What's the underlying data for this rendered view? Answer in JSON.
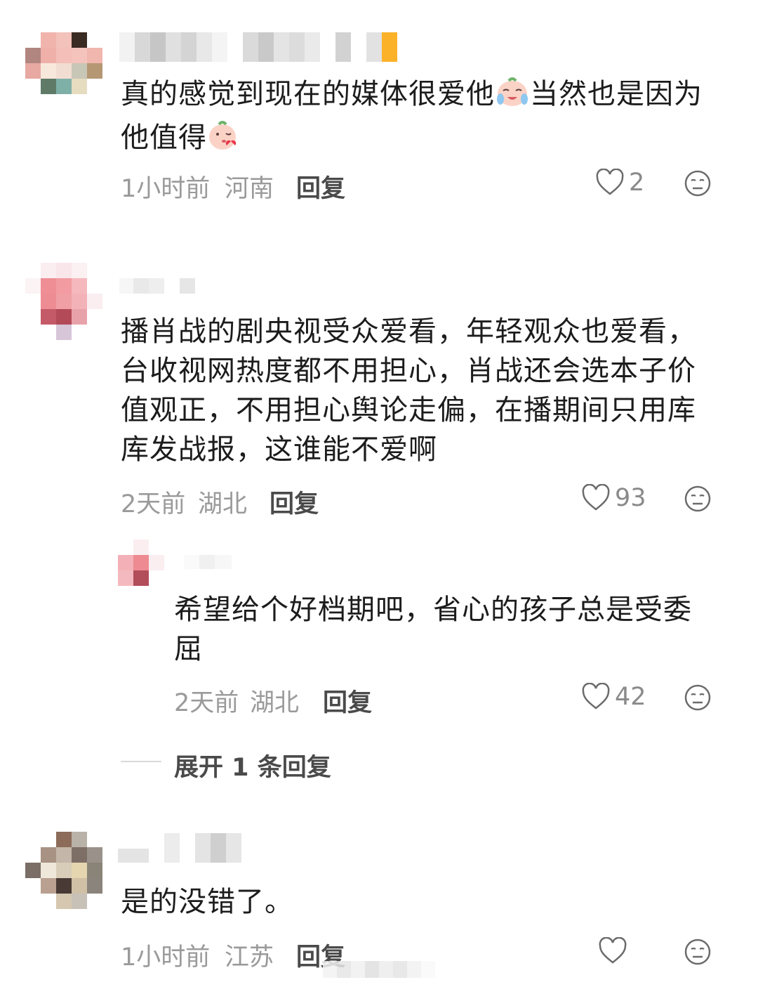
{
  "comments": [
    {
      "text": "真的感觉到现在的媒体很爱他",
      "text_after_emoji": "当然也是因为",
      "text_line2": "他值得",
      "time": "1小时前",
      "location": "河南",
      "reply_label": "回复",
      "likes": "2"
    },
    {
      "lines": [
        "播肖战的剧央视受众爱看，年轻观众也爱看，",
        "台收视网热度都不用担心，肖战还会选本子价",
        "值观正，不用担心舆论走偏，在播期间只用库",
        "库发战报，这谁能不爱啊"
      ],
      "time": "2天前",
      "location": "湖北",
      "reply_label": "回复",
      "likes": "93",
      "replies": [
        {
          "lines": [
            "希望给个好档期吧，省心的孩子总是受委",
            "屈"
          ],
          "time": "2天前",
          "location": "湖北",
          "reply_label": "回复",
          "likes": "42"
        }
      ],
      "expand_label": "展开 1 条回复"
    },
    {
      "text": "是的没错了。",
      "time": "1小时前",
      "location": "江苏",
      "reply_label": "回复",
      "likes": ""
    }
  ],
  "icons": {
    "like": "heart-outline-icon",
    "dislike": "meh-face-icon",
    "emoji_1": "crying-peach-emoji",
    "emoji_2": "kiss-peach-emoji"
  },
  "colors": {
    "text": "#1c1c1c",
    "meta": "#9a9a9a",
    "reply": "#4a4a4a",
    "icon": "#6b6b6b"
  }
}
